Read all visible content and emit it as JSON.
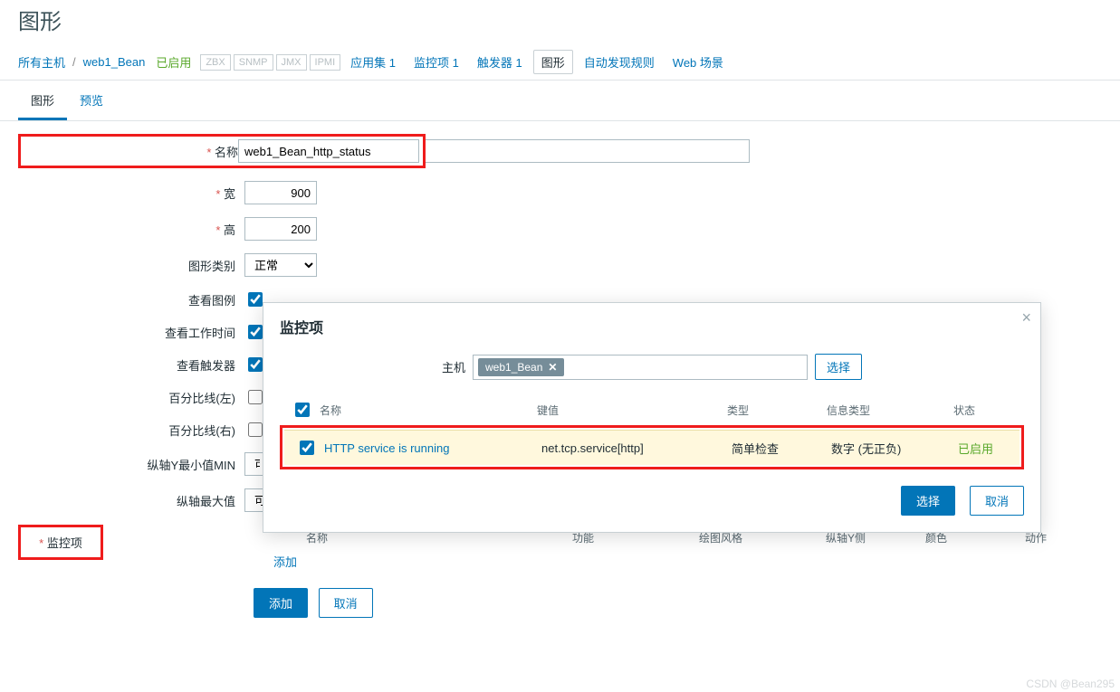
{
  "header": {
    "title": "图形"
  },
  "breadcrumb": {
    "all_hosts": "所有主机",
    "host": "web1_Bean",
    "enabled": "已启用",
    "protos": [
      "ZBX",
      "SNMP",
      "JMX",
      "IPMI"
    ],
    "apps": {
      "label": "应用集",
      "count": "1"
    },
    "items": {
      "label": "监控项",
      "count": "1"
    },
    "triggers": {
      "label": "触发器",
      "count": "1"
    },
    "graphs": "图形",
    "discovery": "自动发现规则",
    "web": "Web 场景"
  },
  "tabs": {
    "graph": "图形",
    "preview": "预览"
  },
  "form": {
    "name_label": "名称",
    "name_value": "web1_Bean_http_status",
    "width_label": "宽",
    "width_value": "900",
    "height_label": "高",
    "height_value": "200",
    "graph_type_label": "图形类别",
    "graph_type_value": "正常",
    "show_legend_label": "查看图例",
    "show_worktime_label": "查看工作时间",
    "show_triggers_label": "查看触发器",
    "percent_left_label": "百分比线(左)",
    "percent_right_label": "百分比线(右)",
    "ymin_label": "纵轴Y最小值MIN",
    "ymin_value": "可",
    "ymax_label": "纵轴最大值",
    "ymax_value": "可计算的",
    "items_label": "监控项",
    "add_link": "添加",
    "cols": {
      "name": "名称",
      "func": "功能",
      "draw": "绘图风格",
      "yaxis": "纵轴Y侧",
      "color": "颜色",
      "action": "动作"
    },
    "btn_add": "添加",
    "btn_cancel": "取消"
  },
  "modal": {
    "title": "监控项",
    "host_label": "主机",
    "host_chip": "web1_Bean",
    "host_select_btn": "选择",
    "cols": {
      "name": "名称",
      "key": "键值",
      "type": "类型",
      "info": "信息类型",
      "status": "状态"
    },
    "row": {
      "name": "HTTP service is running",
      "key": "net.tcp.service[http]",
      "type": "简单检查",
      "info": "数字 (无正负)",
      "status": "已启用"
    },
    "btn_select": "选择",
    "btn_cancel": "取消"
  },
  "watermark": "CSDN @Bean295"
}
